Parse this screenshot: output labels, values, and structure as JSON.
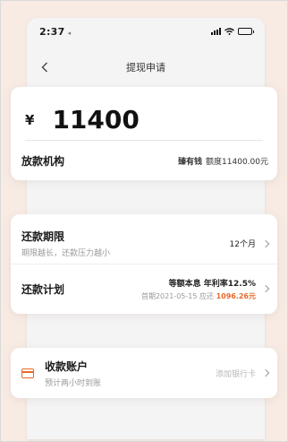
{
  "status": {
    "time": "2:37",
    "location_glyph": "◂"
  },
  "nav": {
    "title": "提现申请"
  },
  "amount": {
    "currency": "¥",
    "value": "11400"
  },
  "lender": {
    "label": "放款机构",
    "name": "臻有钱",
    "quota": "额度11400.00元"
  },
  "term": {
    "title": "还款期限",
    "subtitle": "期限越长，还款压力越小",
    "value": "12个月"
  },
  "plan": {
    "title": "还款计划",
    "method": "等额本息  年利率12.5%",
    "first_date": "首期2021-05-15 应还",
    "first_amount": "1096.26元"
  },
  "account": {
    "title": "收款账户",
    "subtitle": "预计两小时到账",
    "action": "添加银行卡"
  },
  "colors": {
    "accent": "#e8692a",
    "background": "#f8ece6"
  }
}
